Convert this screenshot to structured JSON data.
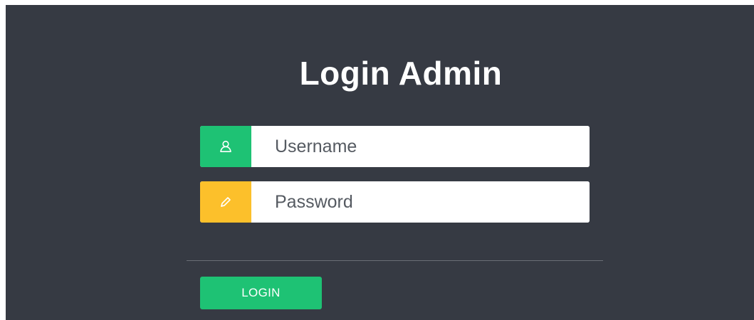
{
  "title": "Login Admin",
  "username": {
    "placeholder": "Username",
    "value": "",
    "icon": "user-icon",
    "accent": "#1ec274"
  },
  "password": {
    "placeholder": "Password",
    "value": "",
    "icon": "pencil-icon",
    "accent": "#fcc02b"
  },
  "login_button": {
    "label": "LOGIN",
    "color": "#1ec274"
  },
  "colors": {
    "background": "#363a43",
    "title": "#ffffff"
  }
}
